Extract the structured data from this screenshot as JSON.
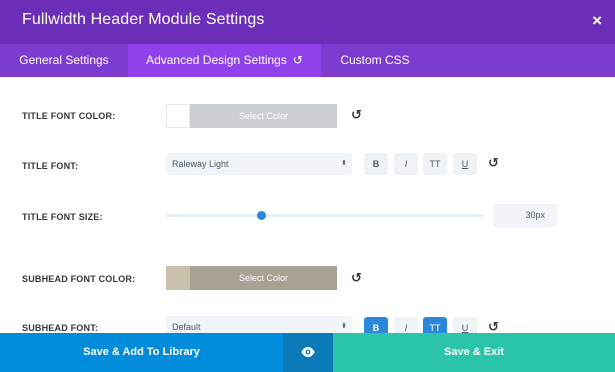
{
  "header": {
    "title": "Fullwidth Header Module Settings",
    "close_icon": "×"
  },
  "tabs": [
    {
      "label": "General Settings",
      "active": false
    },
    {
      "label": "Advanced Design Settings",
      "active": true,
      "reset_icon": "↺"
    },
    {
      "label": "Custom CSS",
      "active": false
    }
  ],
  "fields": {
    "title_font_color": {
      "label": "Title Font Color:",
      "button": "Select Color",
      "swatch_color": "#ffffff",
      "button_color": "#cbcfd4",
      "reset_icon": "↺"
    },
    "title_font": {
      "label": "Title Font:",
      "value": "Raleway Light",
      "caret": "⬍",
      "styles": [
        {
          "name": "bold",
          "glyph": "B",
          "on": false
        },
        {
          "name": "italic",
          "glyph": "I",
          "on": false
        },
        {
          "name": "uppercase",
          "glyph": "TT",
          "on": false
        },
        {
          "name": "underline",
          "glyph": "U",
          "on": false
        }
      ],
      "reset_icon": "↺"
    },
    "title_font_size": {
      "label": "Title Font Size:",
      "value": "30px",
      "slider_level": 0.3
    },
    "subhead_font_color": {
      "label": "Subhead Font Color:",
      "button": "Select Color",
      "swatch_color": "#c9c1ac",
      "button_color": "#a9a294",
      "reset_icon": "↺"
    },
    "subhead_font": {
      "label": "Subhead Font:",
      "value": "Default",
      "caret": "⬍",
      "styles": [
        {
          "name": "bold",
          "glyph": "B",
          "on": true
        },
        {
          "name": "italic",
          "glyph": "I",
          "on": false
        },
        {
          "name": "uppercase",
          "glyph": "TT",
          "on": true
        },
        {
          "name": "underline",
          "glyph": "U",
          "on": false
        }
      ],
      "reset_icon": "↺"
    }
  },
  "footer": {
    "library_label": "Save & Add To Library",
    "preview_icon": "eye-icon",
    "save_label": "Save & Exit"
  },
  "colors": {
    "header": "#6c2eb9",
    "tabs": "#7e3bd0",
    "active_tab": "#8f42ec",
    "accent_blue": "#2b87da",
    "library_button": "#008bdb",
    "save_button": "#29c4a9"
  }
}
